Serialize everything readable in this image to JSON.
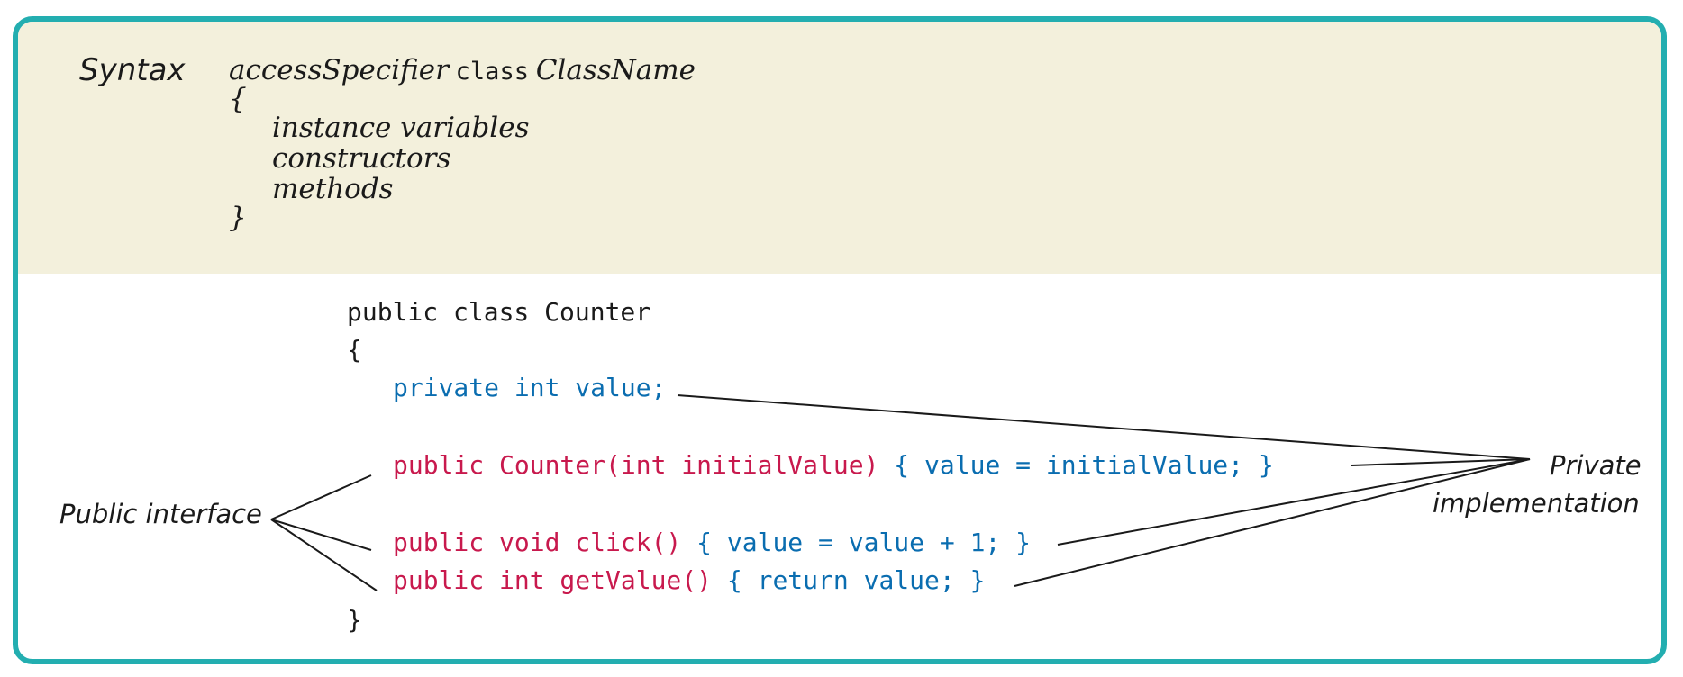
{
  "syntax": {
    "label": "Syntax",
    "line1": {
      "access": "accessSpecifier",
      "keyword": "class",
      "name": "ClassName"
    },
    "open_brace": "{",
    "members": [
      "instance variables",
      "constructors",
      "methods"
    ],
    "close_brace": "}"
  },
  "example": {
    "line_class": "public class Counter",
    "open_brace": "{",
    "field": "private int value;",
    "ctor_sig": "public Counter(int initialValue)",
    "ctor_body": "{ value = initialValue; }",
    "click_sig": "public void click()",
    "click_body": "{ value = value + 1; }",
    "get_sig": "public int getValue()",
    "get_body": "{ return value; }",
    "close_brace": "}"
  },
  "callouts": {
    "public_interface": "Public interface",
    "private_line1": "Private",
    "private_line2": "implementation"
  },
  "colors": {
    "border": "#23aeb0",
    "syntax_background": "#f3f0dc",
    "public_interface_code": "#c8194d",
    "private_implementation_code": "#0a6db0"
  }
}
